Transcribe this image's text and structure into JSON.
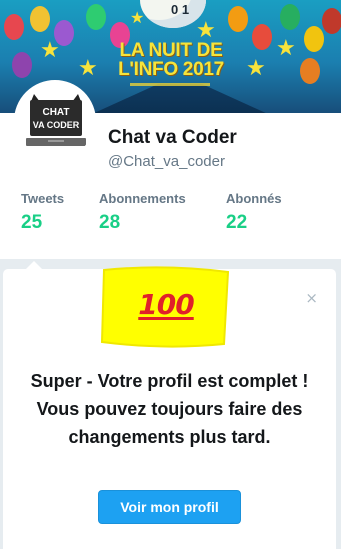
{
  "banner": {
    "title_line1": "LA NUIT DE",
    "title_line2": "L'INFO 2017",
    "moon_text": "0 1"
  },
  "avatar": {
    "logo_line1": "CHAT",
    "logo_line2": "VA CODER"
  },
  "profile": {
    "name": "Chat va Coder",
    "handle": "@Chat_va_coder"
  },
  "stats": {
    "tweets": {
      "label": "Tweets",
      "value": "25"
    },
    "following": {
      "label": "Abonnements",
      "value": "28"
    },
    "followers": {
      "label": "Abonnés",
      "value": "22"
    }
  },
  "prompt": {
    "emoji": "💯",
    "emoji_text": "100",
    "close_glyph": "×",
    "message": "Super - Votre profil est complet ! Vous pouvez toujours faire des changements plus tard.",
    "button_label": "Voir mon profil"
  },
  "colors": {
    "accent_green": "#19cf86",
    "button_blue": "#1da1f2",
    "highlight_yellow": "#ffff00",
    "emoji_red": "#e0212a"
  }
}
